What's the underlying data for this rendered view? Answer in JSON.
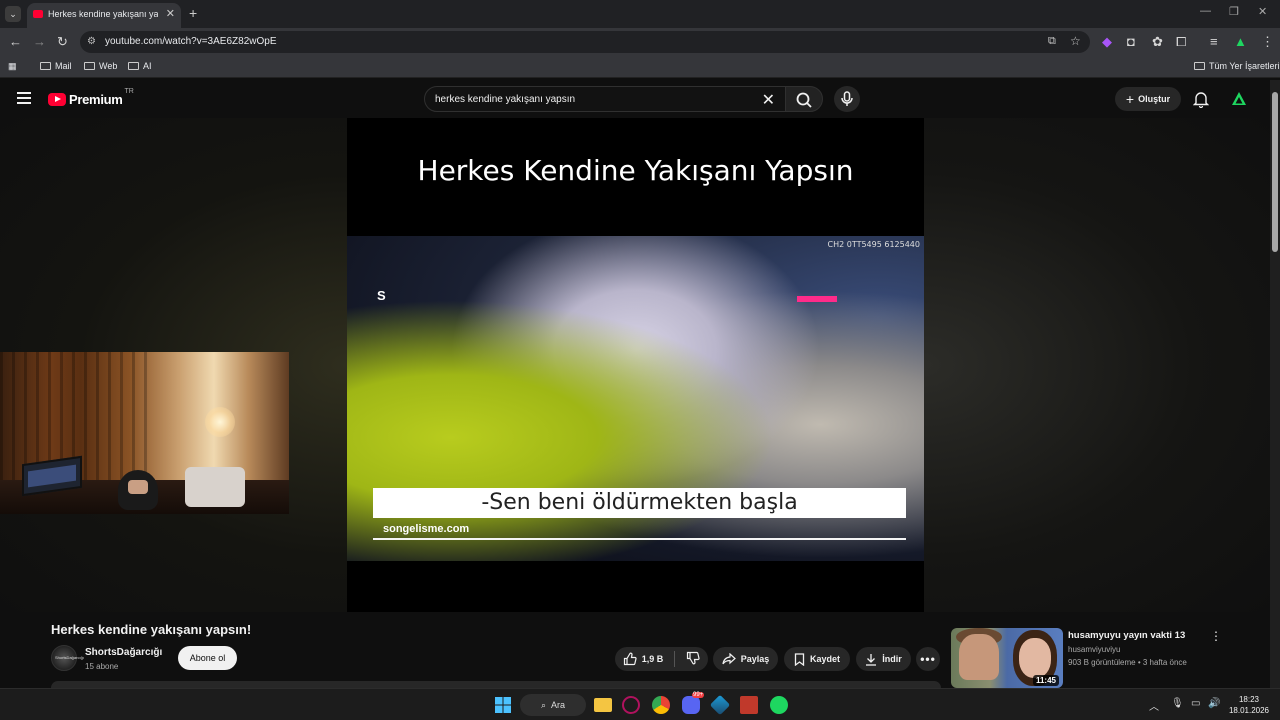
{
  "browser": {
    "tab_title": "Herkes kendine yakışanı yapsın",
    "url": "youtube.com/watch?v=3AE6Z82wOpE",
    "bookmarks": [
      "Mail",
      "Web",
      "AI"
    ],
    "all_bookmarks": "Tüm Yer İşaretleri"
  },
  "youtube": {
    "brand": "Premium",
    "country": "TR",
    "search_query": "herkes kendine yakışanı yapsın",
    "create_label": "Oluştur"
  },
  "video": {
    "overlay_title": "Herkes Kendine Yakışanı Yapsın",
    "clip_code": "CH2 0TT5495 6125440",
    "clip_logo": "S",
    "subtitle": "-Sen beni öldürmekten başla",
    "watermark": "songelisme.com",
    "title": "Herkes kendine yakışanı yapsın!",
    "channel_name": "ShortsDağarcığı",
    "channel_avatar_text": "ShortsDağarcığı",
    "subscribers": "15 abone",
    "subscribe_label": "Abone ol",
    "like_count": "1,9 B",
    "share_label": "Paylaş",
    "save_label": "Kaydet",
    "download_label": "İndir"
  },
  "recommended": {
    "title": "husamyuyu yayın vakti 13",
    "channel": "husamviyuviyu",
    "meta": "903 B görüntüleme • 3 hafta önce",
    "duration": "11:45"
  },
  "taskbar": {
    "search_label": "Ara",
    "time": "18:23",
    "date": "18.01.2026",
    "discord_badge": "99+"
  },
  "colors": {
    "yt_red": "#ff0033",
    "background": "#0f0f0f",
    "accent_green": "#1ed760"
  }
}
